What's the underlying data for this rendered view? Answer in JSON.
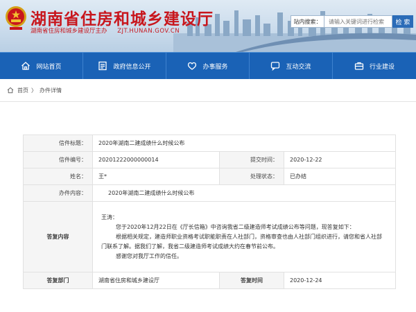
{
  "header": {
    "title": "湖南省住房和城乡建设厅",
    "subtitle": "湖南省住房和城乡建设厅主办",
    "url": "ZJT.HUNAN.GOV.CN",
    "search": {
      "category": "站内搜索：",
      "placeholder": "请输入关键词进行检索",
      "button": "检 索"
    }
  },
  "nav": {
    "items": [
      {
        "label": "网站首页",
        "icon": "home-icon"
      },
      {
        "label": "政府信息公开",
        "icon": "document-icon"
      },
      {
        "label": "办事服务",
        "icon": "heart-icon"
      },
      {
        "label": "互动交流",
        "icon": "chat-icon"
      },
      {
        "label": "行业建设",
        "icon": "briefcase-icon"
      }
    ]
  },
  "breadcrumb": {
    "home": "首页",
    "separator": "〉",
    "current": "办件详情"
  },
  "detail": {
    "title_label": "信件标题：",
    "title_value": "2020年湖南二建成绩什么时候公布",
    "id_label": "信件编号：",
    "id_value": "20201222000000014",
    "submit_label": "提交时间：",
    "submit_value": "2020-12-22",
    "name_label": "姓名：",
    "name_value": "王*",
    "status_label": "处理状态：",
    "status_value": "已办结",
    "content_label": "办件内容：",
    "content_value": "2020年湖南二建成绩什么时候公布",
    "reply_label": "答复内容",
    "reply": {
      "greeting": "王涛：",
      "p1": "您于2020年12月22日在《厅长信箱》中咨询我省二级建造师考试成绩公布等问题，现答复如下：",
      "p2": "根据相关规定，建造师职业资格考试职能职责在人社部门，资格审查也由人社部门组织进行，请您和省人社部门联系了解。据我们了解，我省二级建造师考试成绩大约在春节前公布。",
      "p3": "感谢您对我厅工作的信任。"
    },
    "dept_label": "答复部门",
    "dept_value": "湖南省住房和城乡建设厅",
    "reply_time_label": "答复时间",
    "reply_time_value": "2020-12-24"
  },
  "colors": {
    "brand_red": "#c8161d",
    "nav_blue": "#1a62b6",
    "search_blue": "#2b6cb8"
  }
}
